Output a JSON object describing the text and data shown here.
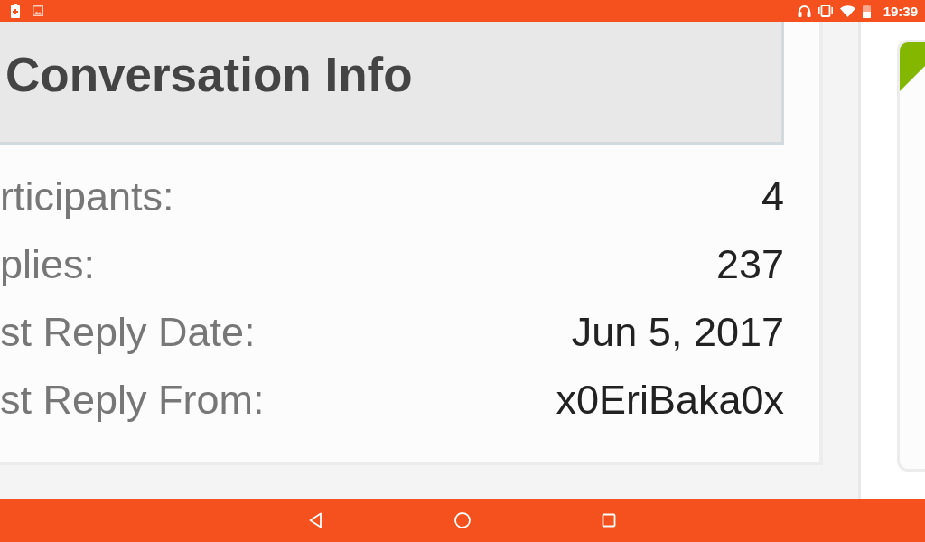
{
  "status_bar": {
    "time": "19:39"
  },
  "header": {
    "title": "Conversation Info"
  },
  "rows": [
    {
      "label": "rticipants:",
      "value": "4"
    },
    {
      "label": "plies:",
      "value": "237"
    },
    {
      "label": "st Reply Date:",
      "value": "Jun 5, 2017"
    },
    {
      "label": "st Reply From:",
      "value": "x0EriBaka0x"
    }
  ]
}
